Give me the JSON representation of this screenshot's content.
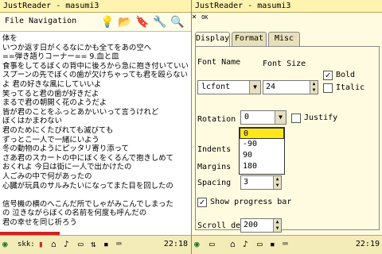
{
  "left": {
    "title": "JustReader - masumi3",
    "menu": [
      "File",
      "Navigation"
    ],
    "toolbar_icons": [
      "lightbulb-icon",
      "open-folder-icon",
      "bookmark-icon",
      "settings-icon",
      "search-icon"
    ],
    "text_lines": [
      "体を",
      "いつか返す日がくるなにかも全てをあの空へ",
      "==弾き語りコーナー== 9.血と皿",
      "食事をしてるぼくの背中に後ろから急に抱き付いていいよ",
      "スプーンの先でぼくの歯が欠けちゃっても君を殴らない",
      "よ 君の好きな風にしていいよ",
      "笑ってると君の歯が好きだよ",
      "まるで君の朝開く花のようだよ",
      "皆が君のことをふっとあかいいって言うけれど",
      "ぼくはかまわない",
      "君のためにくたびれても滅びても",
      "ずっとこ一人で一緒にいよう",
      "冬の動物のようにピッタリ寄り添って",
      "さあ君のスカートの中にぼくをくるんで抱きしめて",
      "おくれよ 今日は街に一人で出かけたの",
      "人ごみの中で何があったの",
      "心臓が玩具のサルみたいになってまた目を回したの",
      "",
      "信号機の横のへこんだ所でしゃがみこんでしまった",
      "の 泣きながらぼくの名前を何度も呼んだの",
      "君の幸せを同じ祈ろう"
    ],
    "taskbar_icons": [
      "start-icon",
      "skk-input-icon",
      "reader-icon",
      "home-icon",
      "volume-icon",
      "battery-icon",
      "network-icon",
      "sd-card-icon",
      "keyboard-icon"
    ],
    "skk_label": "skk:",
    "clock": "22:18"
  },
  "right": {
    "title": "JustReader - masumi3",
    "close_label": "×",
    "ok_label": "OK",
    "tabs": [
      "Display",
      "Format",
      "Misc"
    ],
    "labels": {
      "font_name": "Font Name",
      "font_size": "Font Size",
      "bold": "Bold",
      "italic": "Italic",
      "rotation": "Rotation",
      "justify": "Justify",
      "indents": "Indents",
      "margins": "Margins",
      "spacing": "Spacing",
      "show_progress": "Show progress bar",
      "scroll_delay": "Scroll delay"
    },
    "values": {
      "font_name": "lcfont",
      "font_size": "24",
      "rotation": "0",
      "spacing": "3",
      "scroll_delay": "200"
    },
    "checked": {
      "bold": true,
      "italic": false,
      "justify": false,
      "show_progress": true
    },
    "rotation_options": [
      "0",
      "-90",
      "90",
      "180"
    ],
    "rotation_selected": "0",
    "clock": "22:19"
  }
}
